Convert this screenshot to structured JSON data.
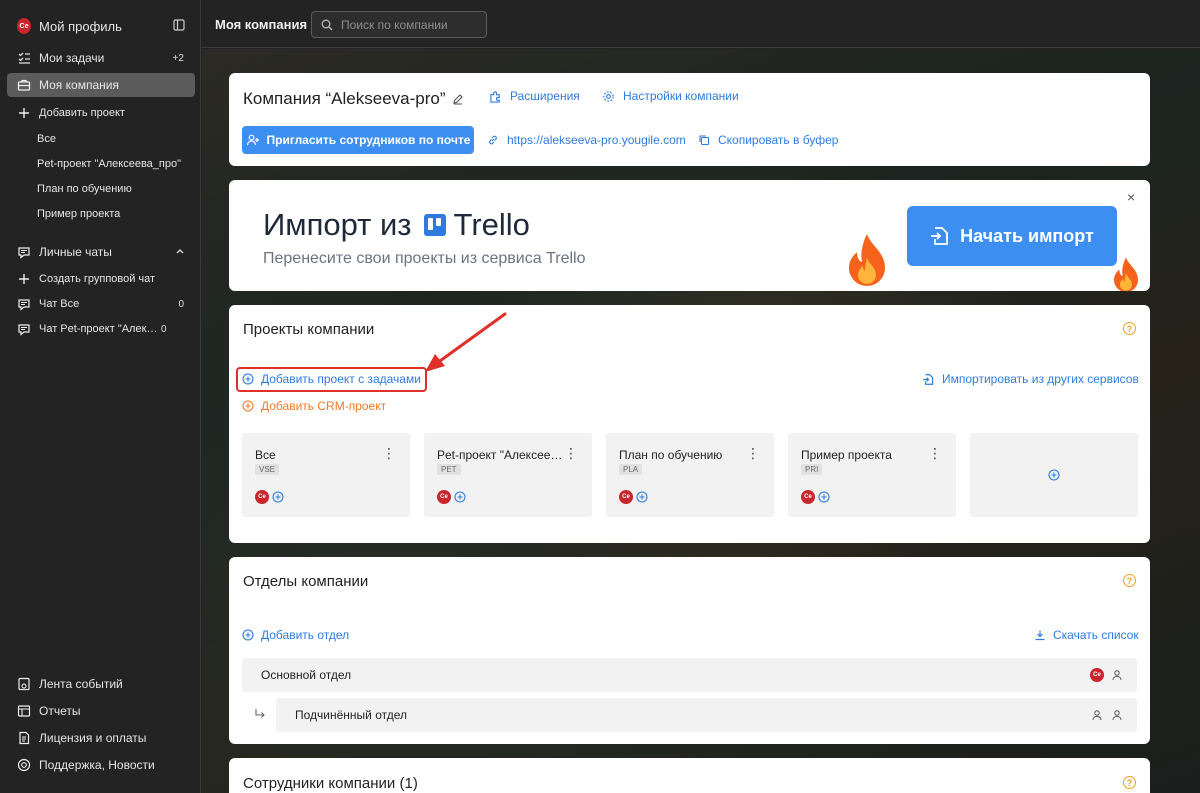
{
  "sidebar": {
    "profile": {
      "avatar": "Се",
      "label": "Мой профиль"
    },
    "items": [
      {
        "label": "Мои задачи",
        "count": "+2"
      },
      {
        "label": "Моя компания"
      },
      {
        "label": "Добавить проект"
      },
      {
        "label": "Все"
      },
      {
        "label": "Pet-проект \"Алексеева_про\""
      },
      {
        "label": "План по обучению"
      },
      {
        "label": "Пример проекта"
      }
    ],
    "chats": {
      "header": "Личные чаты",
      "create": "Создать групповой чат",
      "items": [
        {
          "label": "Чат Все",
          "count": "0"
        },
        {
          "label": "Чат Pet-проект \"Алексеева_про\"",
          "count": "0"
        }
      ]
    },
    "bottom": [
      "Лента событий",
      "Отчеты",
      "Лицензия и оплаты",
      "Поддержка, Новости"
    ]
  },
  "topbar": {
    "title": "Моя компания",
    "search_placeholder": "Поиск по компании"
  },
  "company": {
    "title": "Компания “Alekseeva-pro”",
    "extensions": "Расширения",
    "settings": "Настройки компании",
    "invite_button": "Пригласить сотрудников по почте",
    "url": "https://alekseeva-pro.yougile.com",
    "copy": "Скопировать в буфер"
  },
  "trello_banner": {
    "title_prefix": "Импорт из",
    "brand": "Trello",
    "subtitle": "Перенесите свои проекты из сервиса Trello",
    "button": "Начать импорт",
    "close": "×"
  },
  "projects": {
    "title": "Проекты компании",
    "add_project": "Добавить проект с задачами",
    "add_crm": "Добавить CRM-проект",
    "import": "Импортировать из других сервисов",
    "tiles": [
      {
        "name": "Все",
        "tag": "VSE"
      },
      {
        "name": "Pet-проект \"Алексеева_про\"",
        "tag": "PET"
      },
      {
        "name": "План по обучению",
        "tag": "PLA"
      },
      {
        "name": "Пример проекта",
        "tag": "PRI"
      }
    ],
    "member_avatar": "Се"
  },
  "departments": {
    "title": "Отделы компании",
    "add": "Добавить отдел",
    "download": "Скачать список",
    "items": [
      {
        "name": "Основной отдел"
      },
      {
        "name": "Подчинённый отдел"
      }
    ]
  },
  "employees": {
    "title": "Сотрудники компании",
    "count": "(1)"
  },
  "colors": {
    "accent": "#3c8ff0",
    "crm": "#f07a2a",
    "highlight": "#e0302a",
    "sidebar_bg": "#232323"
  }
}
